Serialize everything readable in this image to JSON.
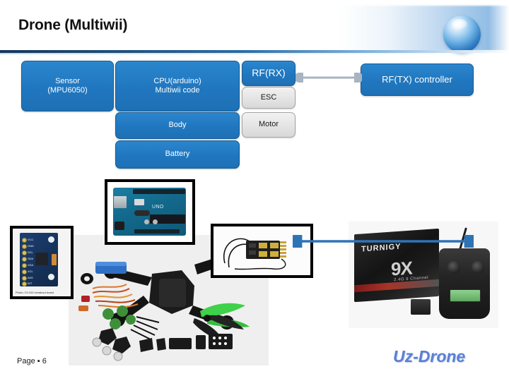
{
  "slide": {
    "title": "Drone (Multiwii)",
    "page_label": "Page ▪ 6",
    "brand": "Uz-Drone",
    "accent_blue": "#2077bf",
    "header_rule_blue": "#17365d",
    "brand_color": "#5b7fd4",
    "gray_node_fill": "#e4e4e4"
  },
  "diagram": {
    "nodes": [
      {
        "id": "sensor",
        "label": "Sensor\n(MPU6050)",
        "line1": "Sensor",
        "line2": "(MPU6050)",
        "style": "blue"
      },
      {
        "id": "cpu",
        "label": "CPU(arduino)\nMultiwii code",
        "line1": "CPU(arduino)",
        "line2": "Multiwii code",
        "style": "blue"
      },
      {
        "id": "rfrx",
        "label": "RF(RX)",
        "style": "blue"
      },
      {
        "id": "esc",
        "label": "ESC",
        "style": "gray"
      },
      {
        "id": "body",
        "label": "Body",
        "style": "blue"
      },
      {
        "id": "motor",
        "label": "Motor",
        "style": "gray"
      },
      {
        "id": "battery",
        "label": "Battery",
        "style": "blue"
      },
      {
        "id": "rftx",
        "label": "RF(TX) controller",
        "style": "blue"
      }
    ],
    "connector": {
      "id": "rx-tx-link",
      "from": "rfrx",
      "to": "rftx",
      "direction": "bidirectional",
      "color": "#a9b4c2"
    }
  },
  "photos": {
    "sensor": {
      "name": "mpu6050-breakout-photo",
      "caption": "Photo: GY-521 breakout board",
      "pin_labels": [
        "VCC",
        "GND",
        "SCL",
        "SDA",
        "XDA",
        "XCL",
        "AD0",
        "INT"
      ]
    },
    "arduino": {
      "name": "arduino-uno-photo",
      "logo_text": "UNO"
    },
    "receiver": {
      "name": "rf-receiver-photo"
    },
    "transmitter": {
      "name": "turnigy-9x-transmitter-photo",
      "box_brand": "TURNIGY",
      "box_model": "9X",
      "box_subtitle": "2.4G 9 Channel"
    },
    "kit": {
      "name": "drone-frame-kit-photo"
    }
  },
  "photo_link": {
    "id": "tx-rx-photo-link",
    "direction": "bidirectional",
    "color": "#2e74b5"
  }
}
